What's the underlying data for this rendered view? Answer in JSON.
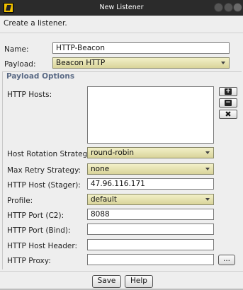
{
  "window": {
    "title": "New Listener"
  },
  "intro_text": "Create a listener.",
  "fields": {
    "name": {
      "label": "Name:",
      "value": "HTTP-Beacon"
    },
    "payload": {
      "label": "Payload:",
      "value": "Beacon HTTP"
    }
  },
  "payload_options": {
    "title": "Payload Options",
    "http_hosts_label": "HTTP Hosts:",
    "host_rotation": {
      "label": "Host Rotation Strategy:",
      "value": "round-robin"
    },
    "max_retry": {
      "label": "Max Retry Strategy:",
      "value": "none"
    },
    "http_host_stager": {
      "label": "HTTP Host (Stager):",
      "value": "47.96.116.171"
    },
    "profile": {
      "label": "Profile:",
      "value": "default"
    },
    "http_port_c2": {
      "label": "HTTP Port (C2):",
      "value": "8088"
    },
    "http_port_bind": {
      "label": "HTTP Port (Bind):",
      "value": ""
    },
    "http_host_header": {
      "label": "HTTP Host Header:",
      "value": ""
    },
    "http_proxy": {
      "label": "HTTP Proxy:",
      "value": "",
      "browse_label": "..."
    }
  },
  "host_buttons": {
    "add": "+",
    "remove": "−",
    "clear": "✖"
  },
  "buttons": {
    "save": "Save",
    "help": "Help"
  },
  "colors": {
    "titlebar": "#2b2b2b",
    "combo": "#e6e2b0",
    "group_title": "#5a6a85"
  }
}
